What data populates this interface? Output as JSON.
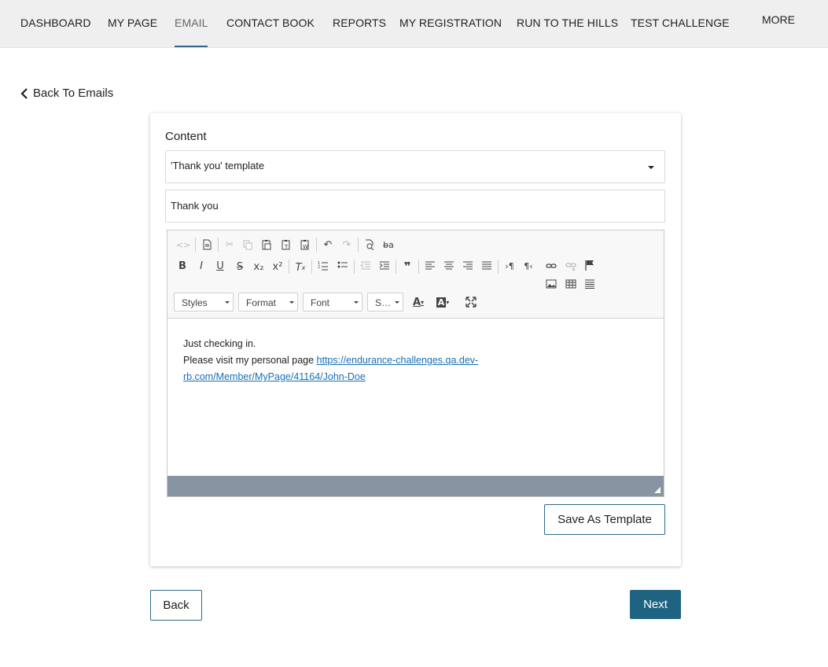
{
  "nav": {
    "items": [
      {
        "label": "DASHBOARD",
        "active": false
      },
      {
        "label": "MY PAGE",
        "active": false
      },
      {
        "label": "EMAIL",
        "active": true
      },
      {
        "label": "CONTACT BOOK",
        "active": false
      },
      {
        "label": "REPORTS",
        "active": false
      },
      {
        "label": "MY REGISTRATION",
        "active": false
      },
      {
        "label": "RUN TO THE HILLS",
        "active": false
      },
      {
        "label": "TEST CHALLENGE",
        "active": false
      }
    ],
    "more_label": "MORE",
    "accent_color": "#2e6a87"
  },
  "back_link": {
    "label": "Back To Emails",
    "icon": "chevron-left-icon"
  },
  "form": {
    "content_label": "Content",
    "template_select": {
      "value": "'Thank you' template"
    },
    "subject": {
      "value": "Thank you"
    },
    "editor": {
      "combos": {
        "styles": "Styles",
        "format": "Format",
        "font": "Font",
        "size": "S…"
      },
      "body": {
        "line1": "Just checking in.",
        "line2_prefix": "Please visit my personal page ",
        "link_line1": "https://endurance-challenges.qa.dev-",
        "link_line2": "rb.com/Member/MyPage/41164/John-Doe"
      }
    },
    "save_template_label": "Save As Template"
  },
  "footer": {
    "back_label": "Back",
    "next_label": "Next",
    "next_color": "#1e6382"
  }
}
